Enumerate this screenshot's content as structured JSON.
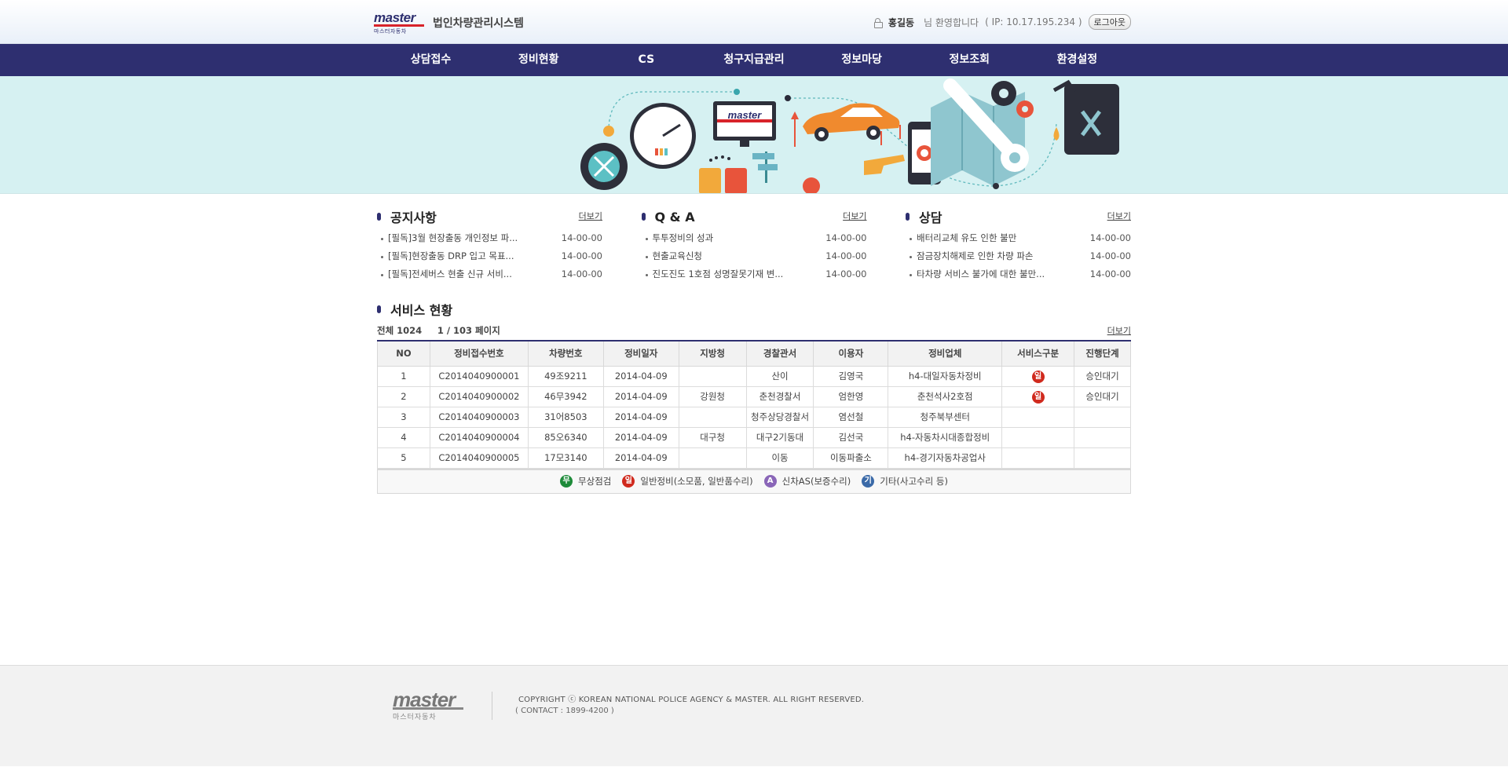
{
  "header": {
    "logo_text": "master",
    "logo_sub": "마스터자동차",
    "system_title": "법인차량관리시스템",
    "user_name": "홍길동",
    "welcome": "님 환영합니다",
    "ip_text": "( IP: 10.17.195.234 )",
    "logout_label": "로그아웃"
  },
  "nav": {
    "items": [
      "상담접수",
      "정비현황",
      "CS",
      "청구지급관리",
      "정보마당",
      "정보조회",
      "환경설정"
    ]
  },
  "banner": {
    "monitor_logo": "master"
  },
  "boards": [
    {
      "title": "공지사항",
      "more": "더보기",
      "items": [
        {
          "title": "[필독]3월 현장출동 개인정보 파...",
          "date": "14-00-00"
        },
        {
          "title": "[필독]현장출동 DRP 입고 목표...",
          "date": "14-00-00"
        },
        {
          "title": "[필독]전세버스 현출 신규 서비...",
          "date": "14-00-00"
        }
      ]
    },
    {
      "title": "Q & A",
      "more": "더보기",
      "items": [
        {
          "title": "투투정비의 성과",
          "date": "14-00-00"
        },
        {
          "title": "현출교육신청",
          "date": "14-00-00"
        },
        {
          "title": "진도진도 1호점 성명잘못기재 변...",
          "date": "14-00-00"
        }
      ]
    },
    {
      "title": "상담",
      "more": "더보기",
      "items": [
        {
          "title": "배터리교체 유도 인한 불만",
          "date": "14-00-00"
        },
        {
          "title": "잠금장치해제로 인한 차량 파손",
          "date": "14-00-00"
        },
        {
          "title": "타차량 서비스 불가에 대한 불만...",
          "date": "14-00-00"
        }
      ]
    }
  ],
  "service": {
    "title": "서비스 현황",
    "total": "전체 1024",
    "page": "1 / 103 페이지",
    "more": "더보기",
    "columns": [
      "NO",
      "정비접수번호",
      "차량번호",
      "정비일자",
      "지방청",
      "경찰관서",
      "이용자",
      "정비업체",
      "서비스구분",
      "진행단계"
    ],
    "rows": [
      {
        "no": "1",
        "receipt": "C2014040900001",
        "car": "49조9211",
        "date": "2014-04-09",
        "region": "",
        "police": "산이",
        "user": "김영국",
        "shop": "h4-대일자동차정비",
        "service": "일",
        "status": "승인대기"
      },
      {
        "no": "2",
        "receipt": "C2014040900002",
        "car": "46무3942",
        "date": "2014-04-09",
        "region": "강원청",
        "police": "춘천경찰서",
        "user": "엄한영",
        "shop": "춘천석사2호점",
        "service": "일",
        "status": "승인대기"
      },
      {
        "no": "3",
        "receipt": "C2014040900003",
        "car": "31어8503",
        "date": "2014-04-09",
        "region": "",
        "police": "청주상당경찰서",
        "user": "염선철",
        "shop": "청주북부센터",
        "service": "",
        "status": ""
      },
      {
        "no": "4",
        "receipt": "C2014040900004",
        "car": "85오6340",
        "date": "2014-04-09",
        "region": "대구청",
        "police": "대구2기동대",
        "user": "김선국",
        "shop": "h4-자동차시대종합정비",
        "service": "",
        "status": ""
      },
      {
        "no": "5",
        "receipt": "C2014040900005",
        "car": "17모3140",
        "date": "2014-04-09",
        "region": "",
        "police": "이동",
        "user": "이동파출소",
        "shop": "h4-경기자동차공업사",
        "service": "",
        "status": ""
      }
    ],
    "legend": [
      {
        "badge": "무",
        "label": "무상점검",
        "color": "#1e8b3a"
      },
      {
        "badge": "일",
        "label": "일반정비(소모품, 일반품수리)",
        "color": "#d02a1e"
      },
      {
        "badge": "A",
        "label": "신차AS(보증수리)",
        "color": "#8a66b8"
      },
      {
        "badge": "기",
        "label": "기타(사고수리 등)",
        "color": "#3b6aa8"
      }
    ],
    "badge_color": "#d02a1e"
  },
  "footer": {
    "logo_text": "master",
    "logo_sub": "마스터자동차",
    "copyright": "COPYRIGHT ⓒ KOREAN NATIONAL POLICE AGENCY & MASTER. ALL RIGHT RESERVED.",
    "contact": "( CONTACT : 1899-4200 )"
  }
}
